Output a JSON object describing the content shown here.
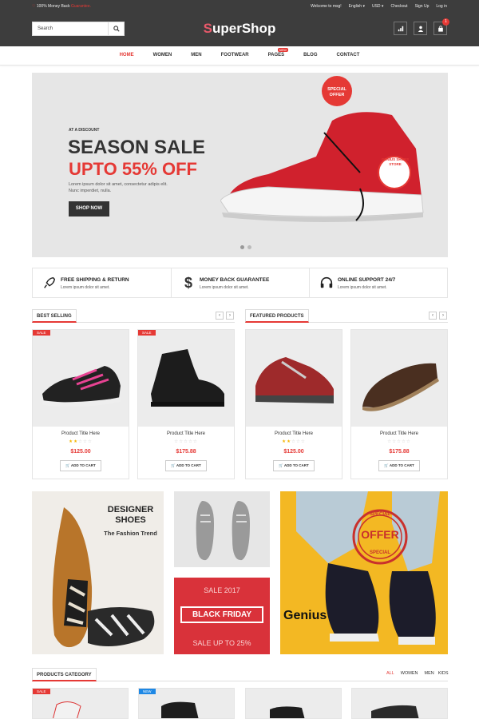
{
  "topbar": {
    "money_back_prefix": "100% Money Back",
    "money_back_highlight": "Guarantee.",
    "welcome": "Welcome to msg!",
    "language": "English",
    "currency": "USD",
    "checkout": "Checkout",
    "signup": "Sign Up",
    "login": "Log in"
  },
  "header": {
    "search_placeholder": "Search",
    "logo_first": "S",
    "logo_rest": "uperShop",
    "cart_count": "1"
  },
  "nav": {
    "items": [
      "HOME",
      "WOMEN",
      "MEN",
      "FOOTWEAR",
      "PAGES",
      "BLOG",
      "CONTACT"
    ],
    "new_badge": "NEW"
  },
  "hero": {
    "pre": "AT A DISCOUNT",
    "title": "SEASON SALE",
    "subtitle": "UPTO 55% OFF",
    "desc": "Lorem ipsum dolor sit amet, consectetur adipis elit. Nunc imperdiet, nulla.",
    "button": "SHOP NOW",
    "badge": "SPECIAL OFFER",
    "shoe_tag": "GENIUS SHOES STORE"
  },
  "features": [
    {
      "title": "FREE SHIPPING & RETURN",
      "desc": "Lorem ipsum dolor sit amet."
    },
    {
      "title": "MONEY BACK GUARANTEE",
      "desc": "Lorem ipsum dolor sit amet."
    },
    {
      "title": "ONLINE SUPPORT 24/7",
      "desc": "Lorem ipsum dolor sit amet."
    }
  ],
  "sections": {
    "best_selling": "BEST SELLING",
    "featured": "FEATURED PRODUCTS",
    "category": "PRODUCTS CATEGORY"
  },
  "products": [
    {
      "title": "Product Title Here",
      "price": "$125.00",
      "rating": 2,
      "tag": "SALE"
    },
    {
      "title": "Product Title Here",
      "price": "$175.88",
      "rating": 0,
      "tag": "SALE"
    },
    {
      "title": "Product Title Here",
      "price": "$125.00",
      "rating": 2,
      "tag": ""
    },
    {
      "title": "Product Title Here",
      "price": "$175.88",
      "rating": 0,
      "tag": ""
    }
  ],
  "add_to_cart": "ADD TO CART",
  "banners": {
    "designer": "DESIGNER SHOES",
    "designer_sub": "The Fashion Trend",
    "sale_year": "SALE 2017",
    "black_friday": "BLACK FRIDAY",
    "sale_upto": "SALE UP TO 25%",
    "genius": "Genius",
    "offer": "OFFER",
    "offer_top": "SPECIAL",
    "offer_bottom": "SPECIAL"
  },
  "category_tabs": [
    "ALL",
    "WOMEN",
    "MEN",
    "KIDS"
  ],
  "category_tags": [
    "SALE",
    "NEW"
  ]
}
